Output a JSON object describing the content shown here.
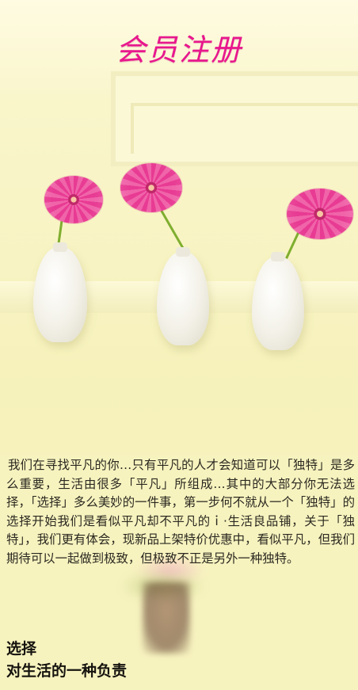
{
  "header": {
    "title": "会员注册"
  },
  "article": {
    "paragraph": "我们在寻找平凡的你…只有平凡的人才会知道可以「独特」是多么重要，生活由很多「平凡」所组成…其中的大部分你无法选择，「选择」多么美妙的一件事，第一步何不就从一个「独特」的选择开始我们是看似平凡却不平凡的ｉ·生活良品铺，关于「独特」，我们更有体会，现新品上架特价优惠中，看似平凡，但我们期待可以一起做到极致，但极致不正是另外一种独特。"
  },
  "footer": {
    "line1": "选择",
    "line2": "对生活的一种负责"
  },
  "colors": {
    "title": "#e8178d",
    "background": "#f7f3bf",
    "text": "#2a2820"
  },
  "icons": [
    "pink-gerbera-flower",
    "white-vase"
  ]
}
